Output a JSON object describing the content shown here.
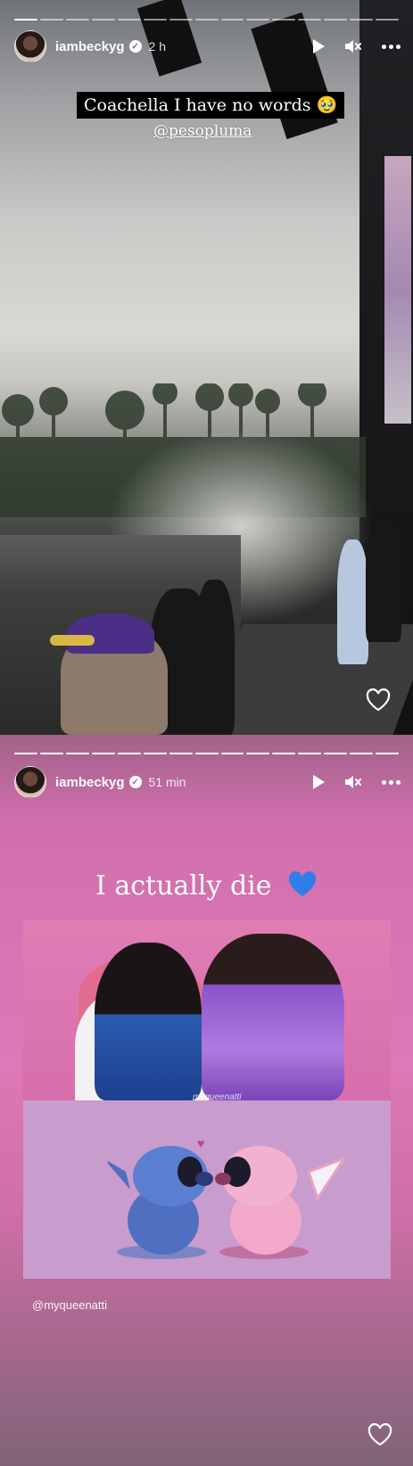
{
  "stories": [
    {
      "progress_segments": 15,
      "active_segment": 1,
      "header": {
        "username": "iambeckyg",
        "verified_mark": "✓",
        "time": "2 h"
      },
      "caption": "Coachella I have no words 🥹",
      "mention": "@pesopluma",
      "icons": {
        "play": "play-icon",
        "mute": "speaker-muted-icon",
        "more": "more-options-icon",
        "like": "heart-outline-icon"
      }
    },
    {
      "progress_segments": 15,
      "active_segment": 15,
      "header": {
        "username": "iambeckyg",
        "verified_mark": "✓",
        "time": "51 min"
      },
      "caption": "I actually die",
      "caption_emoji": "blue-heart-icon",
      "photo_credit_watermark": "myqueenatti",
      "mention": "@myqueenatti",
      "icons": {
        "play": "play-icon",
        "mute": "speaker-muted-icon",
        "more": "more-options-icon",
        "like": "heart-outline-icon"
      }
    }
  ],
  "colors": {
    "caption_box": "#000000",
    "text": "#ffffff",
    "story2_background": "#de78b6",
    "blue_heart": "#2f7ee8"
  }
}
